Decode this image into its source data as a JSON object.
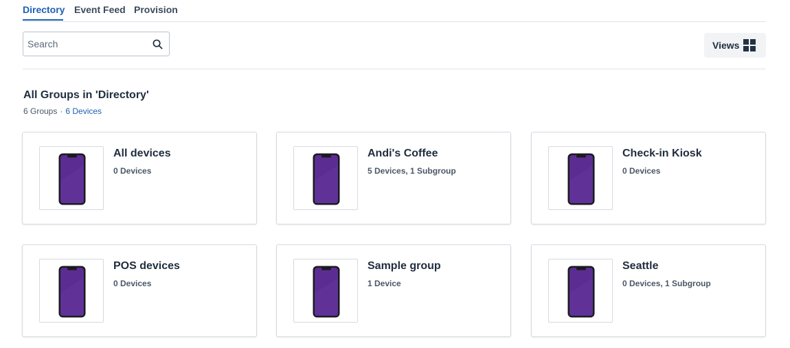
{
  "tabs": [
    {
      "label": "Directory",
      "active": true
    },
    {
      "label": "Event Feed",
      "active": false
    },
    {
      "label": "Provision",
      "active": false
    }
  ],
  "search": {
    "placeholder": "Search",
    "value": "",
    "icon": "search-icon"
  },
  "views": {
    "label": "Views",
    "icon": "grid-view-icon"
  },
  "section": {
    "title": "All Groups in 'Directory'",
    "groups_count": "6 Groups",
    "separator": "·",
    "devices_count": "6 Devices"
  },
  "groups": [
    {
      "name": "All devices",
      "summary": "0 Devices"
    },
    {
      "name": "Andi's Coffee",
      "summary": "5 Devices, 1 Subgroup"
    },
    {
      "name": "Check-in Kiosk",
      "summary": "0 Devices"
    },
    {
      "name": "POS devices",
      "summary": "0 Devices"
    },
    {
      "name": "Sample group",
      "summary": "1 Device"
    },
    {
      "name": "Seattle",
      "summary": "0 Devices, 1 Subgroup"
    }
  ],
  "colors": {
    "accent": "#1d5fb4",
    "phone_screen": "#5b2d91",
    "phone_frame": "#1a1a1f"
  }
}
